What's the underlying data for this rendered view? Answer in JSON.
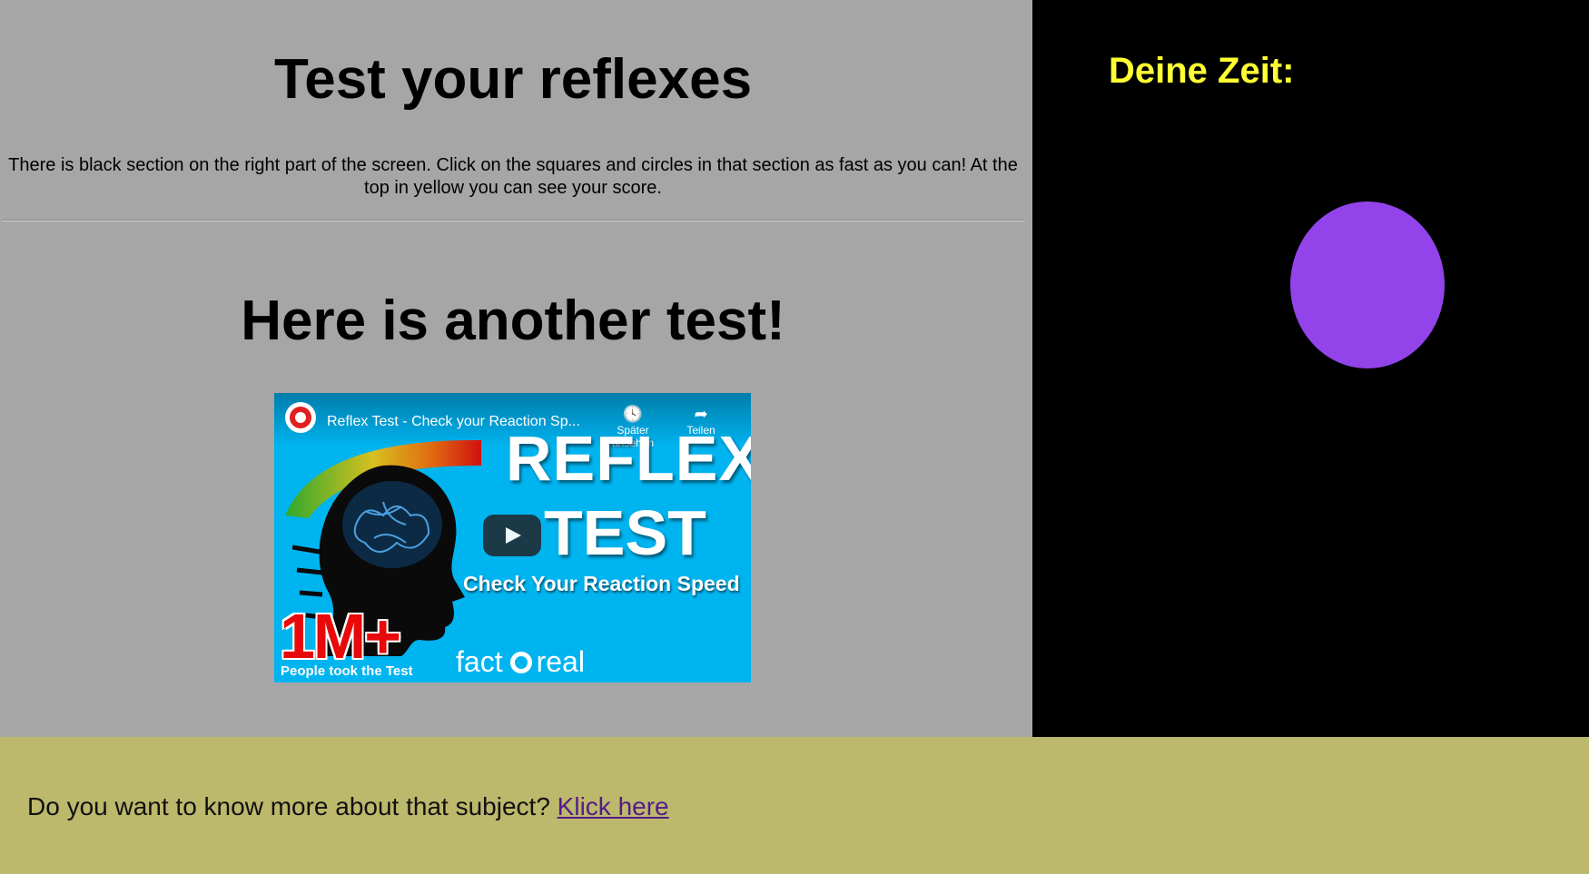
{
  "page": {
    "background": "#bcb86c"
  },
  "left_panel": {
    "background": "#a6a6a6",
    "title": "Test your reflexes",
    "instructions": "There is black section on the right part of the screen. Click on the squares and circles in that section as fast as you can! At the top in yellow you can see your score.",
    "second_title": "Here is another test!"
  },
  "video": {
    "title": "Reflex Test - Check your Reaction Sp...",
    "watch_later_label": "Später ansehen",
    "watch_later_icon": "clock-icon",
    "share_label": "Teilen",
    "share_icon": "share-arrow-icon",
    "thumbnail": {
      "headline_1": "REFLEX",
      "headline_2": "TEST",
      "subline": "Check Your Reaction Speed",
      "count": "1M+",
      "count_caption": "People took the Test",
      "brand_left": "fact",
      "brand_right": "real"
    },
    "play_icon": "play-icon",
    "background": "#00b4f0"
  },
  "game": {
    "background": "#000000",
    "score_label": "Deine Zeit:",
    "score_color": "#ffff33",
    "target": {
      "shape": "circle",
      "color": "#9244ea"
    }
  },
  "footer": {
    "text": "Do you want to know more about that subject?",
    "link_text": "Klick here"
  }
}
